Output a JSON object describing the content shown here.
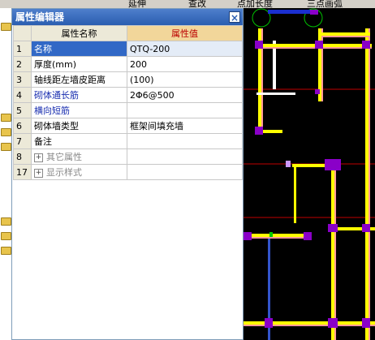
{
  "toolbar": {
    "items": [
      "延伸",
      "查改",
      "点加长度",
      "三点画弧"
    ]
  },
  "panel": {
    "title": "属性编辑器",
    "col_name": "属性名称",
    "col_value": "属性值",
    "rows": [
      {
        "num": "1",
        "name": "名称",
        "value": "QTQ-200"
      },
      {
        "num": "2",
        "name": "厚度(mm)",
        "value": "200"
      },
      {
        "num": "3",
        "name": "轴线距左墙皮距离",
        "value": "(100)"
      },
      {
        "num": "4",
        "name": "砌体通长筋",
        "value": "2Φ6@500"
      },
      {
        "num": "5",
        "name": "横向短筋",
        "value": ""
      },
      {
        "num": "6",
        "name": "砌体墙类型",
        "value": "框架间填充墙"
      },
      {
        "num": "7",
        "name": "备注",
        "value": ""
      },
      {
        "num": "8",
        "name": "其它属性",
        "value": ""
      },
      {
        "num": "17",
        "name": "显示样式",
        "value": ""
      }
    ]
  },
  "colors": {
    "title_bar": "#2a5db0",
    "selected_row": "#3168c6",
    "value_header": "#f2d69a",
    "wall_yellow": "#ffff00",
    "wall_purple": "#8a00c8",
    "axis_red": "#c00000"
  }
}
